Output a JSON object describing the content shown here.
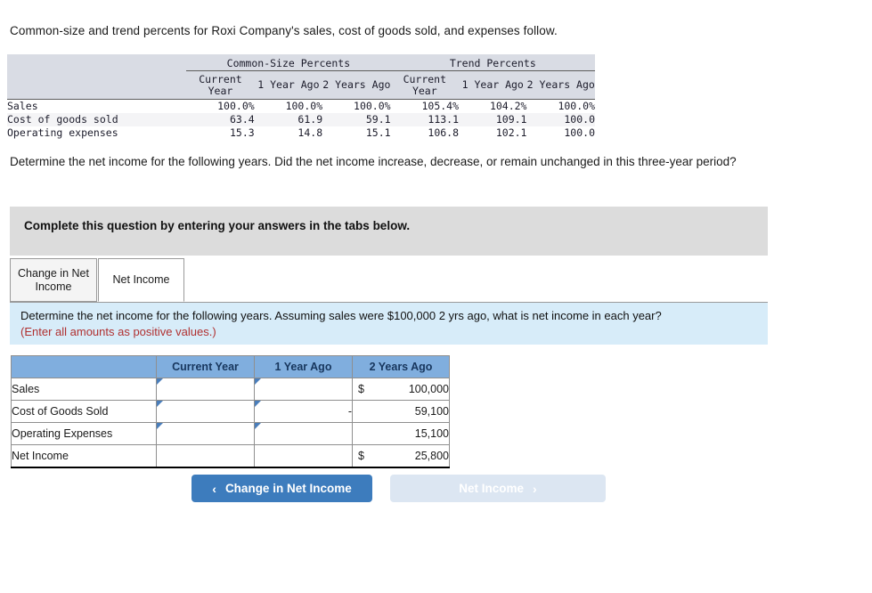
{
  "intro": "Common-size and trend percents for Roxi Company's sales, cost of goods sold, and expenses follow.",
  "percents_table": {
    "groups": [
      {
        "label": "Common-Size Percents"
      },
      {
        "label": "Trend Percents"
      }
    ],
    "columns": [
      "Current Year",
      "1 Year Ago",
      "2 Years Ago",
      "Current Year",
      "1 Year Ago",
      "2 Years Ago"
    ],
    "rows": [
      {
        "label": "Sales",
        "values": [
          "100.0%",
          "100.0%",
          "100.0%",
          "105.4%",
          "104.2%",
          "100.0%"
        ]
      },
      {
        "label": "Cost of goods sold",
        "values": [
          "63.4",
          "61.9",
          "59.1",
          "113.1",
          "109.1",
          "100.0"
        ]
      },
      {
        "label": "Operating expenses",
        "values": [
          "15.3",
          "14.8",
          "15.1",
          "106.8",
          "102.1",
          "100.0"
        ]
      }
    ]
  },
  "question": "Determine the net income for the following years. Did the net income increase, decrease, or remain unchanged in this three-year period?",
  "complete_bar": {
    "text": "Complete this question by entering your answers in the tabs below."
  },
  "tabs": [
    {
      "label": "Change in Net Income",
      "active": false
    },
    {
      "label": "Net Income",
      "active": true
    }
  ],
  "blue_panel": {
    "line1": "Determine the net income for the following years. Assuming sales were $100,000 2 yrs ago, what is net income in each year?",
    "line2": "(Enter all amounts as positive values.)"
  },
  "answer_table": {
    "headers": [
      "",
      "Current Year",
      "1 Year Ago",
      "2 Years Ago"
    ],
    "rows": [
      {
        "label": "Sales",
        "current_year": "",
        "one_year_ago": "",
        "two_years_ago_currency": "$",
        "two_years_ago": "100,000"
      },
      {
        "label": "Cost of Goods Sold",
        "current_year": "",
        "one_year_ago": "-",
        "two_years_ago_currency": "",
        "two_years_ago": "59,100"
      },
      {
        "label": "Operating Expenses",
        "current_year": "",
        "one_year_ago": "",
        "two_years_ago_currency": "",
        "two_years_ago": "15,100"
      },
      {
        "label": "Net Income",
        "current_year": "",
        "one_year_ago": "",
        "two_years_ago_currency": "$",
        "two_years_ago": "25,800"
      }
    ]
  },
  "nav": {
    "prev_label": "Change in Net Income",
    "prev_chevron": "‹",
    "next_label": "Net Income",
    "next_chevron": "›"
  },
  "colors": {
    "accent_blue": "#3d7cbd",
    "header_blue": "#80aede",
    "panel_blue": "#d7ecf9",
    "table_header_gray": "#d9dce4",
    "complete_bar_gray": "#dcdcdc",
    "warning_red": "#b03030",
    "input_border": "#4a7ebb"
  }
}
